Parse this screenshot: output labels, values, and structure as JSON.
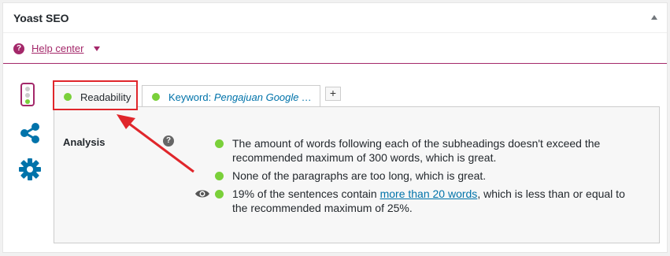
{
  "box": {
    "title": "Yoast SEO",
    "toggle_icon": "triangle-up-icon"
  },
  "help": {
    "icon": "question-circle-icon",
    "link_label": "Help center",
    "caret_icon": "caret-down-icon"
  },
  "sidebar": {
    "items": [
      {
        "name": "traffic-light-icon"
      },
      {
        "name": "share-icon"
      },
      {
        "name": "gear-icon"
      }
    ]
  },
  "tabs": [
    {
      "label": "Readability",
      "active": true,
      "status": "good"
    },
    {
      "label_prefix": "Keyword: ",
      "label_term": "Pengajuan Google A...",
      "active": false,
      "status": "good"
    }
  ],
  "add_tab_label": "+",
  "analysis": {
    "label": "Analysis",
    "help_icon": "?",
    "results": [
      {
        "text": "The amount of words following each of the subheadings doesn't exceed the recommended maximum of 300 words, which is great.",
        "status": "good"
      },
      {
        "text": "None of the paragraphs are too long, which is great.",
        "status": "good"
      },
      {
        "text_before": "19% of the sentences contain ",
        "link": "more than 20 words",
        "text_after": ", which is less than or equal to the recommended maximum of 25%.",
        "status": "good",
        "has_eye": true
      }
    ]
  },
  "colors": {
    "brand": "#a4286a",
    "good": "#7ad03a",
    "link": "#0073aa",
    "annotation": "#e0262b"
  }
}
